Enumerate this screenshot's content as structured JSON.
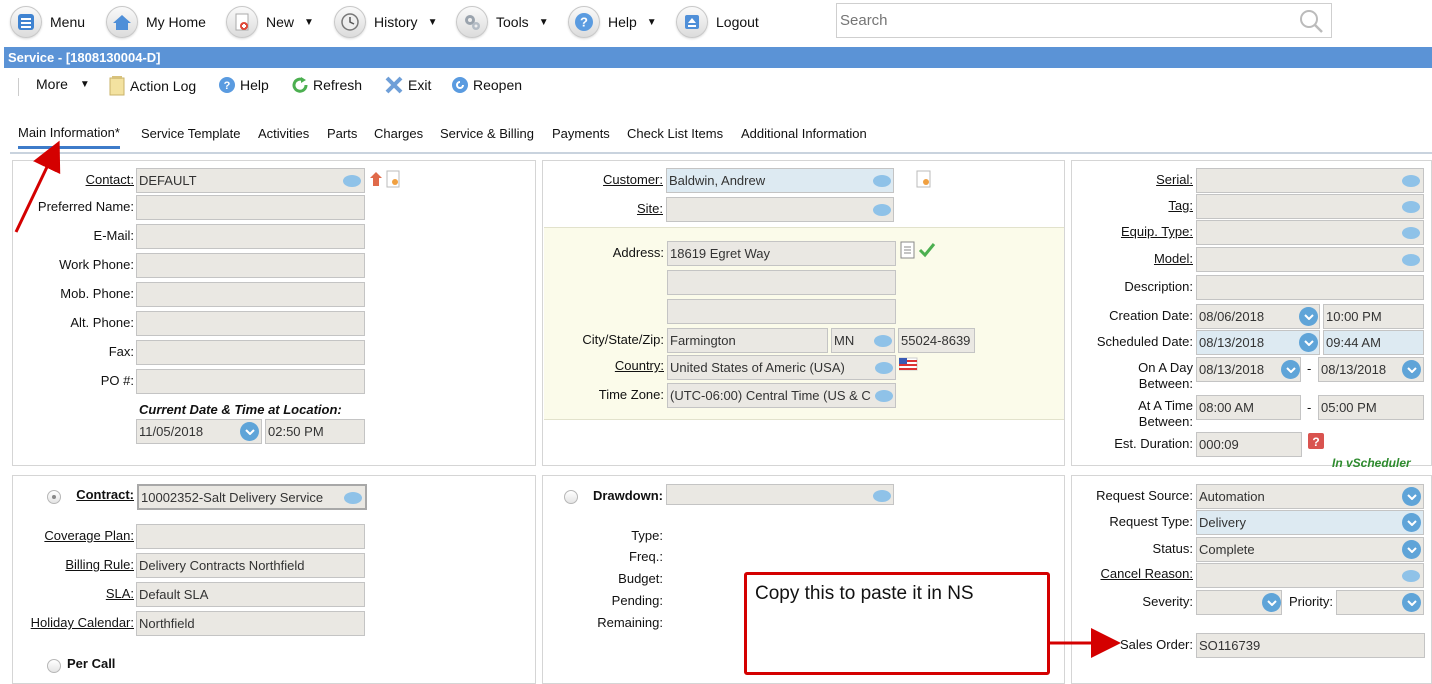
{
  "nav": {
    "menu": "Menu",
    "home": "My Home",
    "new": "New",
    "history": "History",
    "tools": "Tools",
    "help": "Help",
    "logout": "Logout",
    "search_placeholder": "Search"
  },
  "window": {
    "title": "Service - [1808130004-D]"
  },
  "toolbar": {
    "more": "More",
    "action_log": "Action Log",
    "help": "Help",
    "refresh": "Refresh",
    "exit": "Exit",
    "reopen": "Reopen"
  },
  "tabs": [
    "Main Information*",
    "Service Template",
    "Activities",
    "Parts",
    "Charges",
    "Service & Billing",
    "Payments",
    "Check List Items",
    "Additional Information"
  ],
  "contact_panel": {
    "contact_label": "Contact:",
    "contact_value": "DEFAULT",
    "preferred_name_label": "Preferred Name:",
    "email_label": "E-Mail:",
    "work_phone_label": "Work Phone:",
    "mob_phone_label": "Mob. Phone:",
    "alt_phone_label": "Alt. Phone:",
    "fax_label": "Fax:",
    "po_label": "PO #:",
    "current_dt_label": "Current Date & Time at Location:",
    "current_date": "11/05/2018",
    "current_time": "02:50 PM"
  },
  "customer_panel": {
    "customer_label": "Customer:",
    "customer_value": "Baldwin, Andrew",
    "site_label": "Site:",
    "address_label": "Address:",
    "address_line1": "18619 Egret Way",
    "city_label": "City/State/Zip:",
    "city": "Farmington",
    "state": "MN",
    "zip": "55024-8639",
    "country_label": "Country:",
    "country": "United States of Americ (USA)",
    "timezone_label": "Time Zone:",
    "timezone": "(UTC-06:00) Central Time (US & C"
  },
  "equipment_panel": {
    "serial_label": "Serial:",
    "tag_label": "Tag:",
    "equip_type_label": "Equip. Type:",
    "model_label": "Model:",
    "description_label": "Description:",
    "creation_date_label": "Creation Date:",
    "creation_date": "08/06/2018",
    "creation_time": "10:00 PM",
    "scheduled_date_label": "Scheduled Date:",
    "scheduled_date": "08/13/2018",
    "scheduled_time": "09:44 AM",
    "on_a_day_label": "On A Day",
    "between_label": "Between:",
    "day_from": "08/13/2018",
    "day_to": "08/13/2018",
    "at_a_time_label": "At A Time",
    "time_from": "08:00 AM",
    "time_to": "05:00 PM",
    "dash": "-",
    "est_duration_label": "Est. Duration:",
    "est_duration": "000:09",
    "in_vscheduler": "In vScheduler"
  },
  "contract_panel": {
    "contract_label": "Contract:",
    "contract_value": "10002352-Salt Delivery Service",
    "coverage_plan_label": "Coverage Plan:",
    "billing_rule_label": "Billing Rule:",
    "billing_rule": "Delivery Contracts Northfield",
    "sla_label": "SLA:",
    "sla": "Default SLA",
    "holiday_label": "Holiday Calendar:",
    "holiday": "Northfield",
    "per_call_label": "Per Call"
  },
  "drawdown_panel": {
    "drawdown_label": "Drawdown:",
    "type_label": "Type:",
    "freq_label": "Freq.:",
    "budget_label": "Budget:",
    "pending_label": "Pending:",
    "remaining_label": "Remaining:"
  },
  "request_panel": {
    "request_source_label": "Request Source:",
    "request_source": "Automation",
    "request_type_label": "Request Type:",
    "request_type": "Delivery",
    "status_label": "Status:",
    "status": "Complete",
    "cancel_reason_label": "Cancel Reason:",
    "severity_label": "Severity:",
    "priority_label": "Priority:",
    "sales_order_label": "Sales Order:",
    "sales_order": "SO116739"
  },
  "annotation": {
    "callout_text": "Copy this to paste it in NS",
    "arrow_color": "#d40000"
  }
}
